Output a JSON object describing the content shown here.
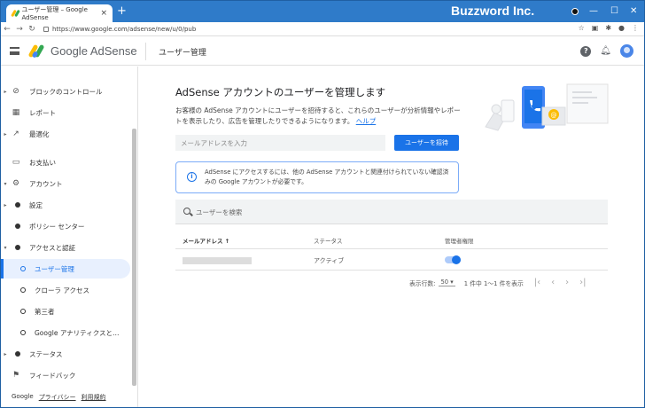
{
  "browser": {
    "tab_title": "ユーザー管理 – Google AdSense",
    "tab_close": "×",
    "new_tab": "+",
    "brand_overlay": "Buzzword Inc.",
    "url": "https://www.google.com/adsense/new/u/0/pub",
    "window_controls": {
      "minimize": "—",
      "maximize": "☐",
      "close": "✕"
    }
  },
  "header": {
    "product_name": "Google AdSense",
    "page_title": "ユーザー管理",
    "help_label": "?"
  },
  "sidebar": {
    "items": [
      {
        "label": "ブロックのコントロール",
        "icon": "block-icon",
        "glyph": "⊘",
        "arrow": "▸"
      },
      {
        "label": "レポート",
        "icon": "report-icon",
        "glyph": "▦",
        "arrow": ""
      },
      {
        "label": "最適化",
        "icon": "trending-icon",
        "glyph": "↗",
        "arrow": "▸"
      },
      {
        "label": "お支払い",
        "icon": "payment-icon",
        "glyph": "▭",
        "arrow": ""
      },
      {
        "label": "アカウント",
        "icon": "gear-icon",
        "glyph": "⚙",
        "arrow": "▾"
      }
    ],
    "subitems": [
      {
        "label": "設定",
        "arrow": "▸"
      },
      {
        "label": "ポリシー センター",
        "arrow": ""
      },
      {
        "label": "アクセスと認証",
        "arrow": "▾"
      }
    ],
    "subsubitems": [
      {
        "label": "ユーザー管理",
        "active": true
      },
      {
        "label": "クローラ アクセス",
        "active": false
      },
      {
        "label": "第三者",
        "active": false
      },
      {
        "label": "Google アナリティクスと…",
        "active": false
      }
    ],
    "bottom_items": [
      {
        "label": "ステータス",
        "arrow": "▸"
      },
      {
        "label": "フィードバック",
        "icon": "feedback-icon",
        "glyph": "⚑"
      }
    ],
    "footer": {
      "brand": "Google",
      "privacy": "プライバシー",
      "terms": "利用規約"
    }
  },
  "main": {
    "heading": "AdSense アカウントのユーザーを管理します",
    "description": "お客様の AdSense アカウントにユーザーを招待すると、これらのユーザーが分析情報やレポートを表示したり、広告を管理したりできるようになります。",
    "help_link": "ヘルプ",
    "email_placeholder": "メールアドレスを入力",
    "invite_button": "ユーザーを招待",
    "info_icon": "i",
    "info_text": "AdSense にアクセスするには、他の AdSense アカウントと関連付けられていない確認済みの Google アカウントが必要です。",
    "search_placeholder": "ユーザーを検索",
    "table": {
      "col_email": "メールアドレス ↑",
      "col_status": "ステータス",
      "col_admin": "管理者権限",
      "rows": [
        {
          "status": "アクティブ",
          "admin_enabled": true
        }
      ]
    },
    "pagination": {
      "rows_label": "表示行数:",
      "rows_value": "50",
      "range": "1 件中 1〜1 件を表示",
      "first": "|‹",
      "prev": "‹",
      "next": "›",
      "last": "›|"
    }
  },
  "colors": {
    "accent": "#1a73e8",
    "titlebar": "#2f7bc9"
  }
}
